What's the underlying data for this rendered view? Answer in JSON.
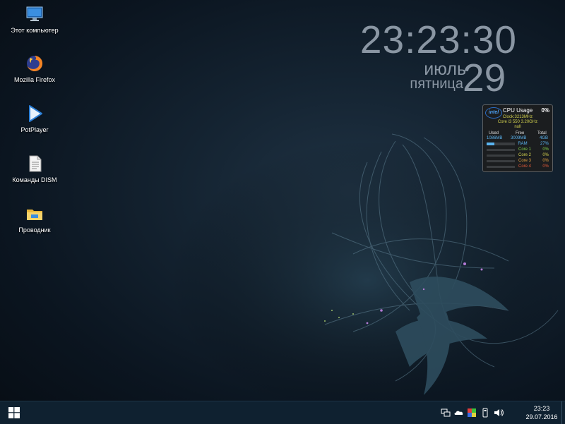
{
  "desktop": {
    "icons": [
      {
        "label": "Этот компьютер",
        "icon": "computer-icon"
      },
      {
        "label": "Mozilla Firefox",
        "icon": "firefox-icon"
      },
      {
        "label": "PotPlayer",
        "icon": "potplayer-icon"
      },
      {
        "label": "Команды DISM",
        "icon": "document-icon"
      },
      {
        "label": "Проводник",
        "icon": "folder-icon"
      }
    ]
  },
  "clock_gadget": {
    "time": "23:23:30",
    "month": "июль",
    "weekday": "пятница",
    "date": "29"
  },
  "cpu_gadget": {
    "title": "CPU Usage",
    "usage": "0%",
    "logo": "intel",
    "clock": "Clock:3213MHz",
    "model": "Core i3 550 3.20GHz",
    "extra": "null",
    "headers": {
      "used": "Used",
      "free": "Free",
      "total": "Total"
    },
    "memory": {
      "used": "1086MB",
      "free": "3009MB",
      "total": "4GB"
    },
    "ram_label": "RAM",
    "ram_percent": "27%",
    "ram_fraction": 0.27,
    "cores": [
      {
        "label": "Core 1",
        "value": "0%",
        "color": "#7fd04a"
      },
      {
        "label": "Core 2",
        "value": "0%",
        "color": "#d4d24e"
      },
      {
        "label": "Core 3",
        "value": "0%",
        "color": "#e0a040"
      },
      {
        "label": "Core 4",
        "value": "0%",
        "color": "#e05a3a"
      }
    ]
  },
  "taskbar": {
    "start_icon": "windows-logo-icon",
    "tray_icons": [
      "network-icon",
      "cloud-icon",
      "color-icon",
      "usb-icon",
      "volume-icon"
    ],
    "time": "23:23",
    "date": "29.07.2016",
    "accent": "#4cc2ff"
  }
}
